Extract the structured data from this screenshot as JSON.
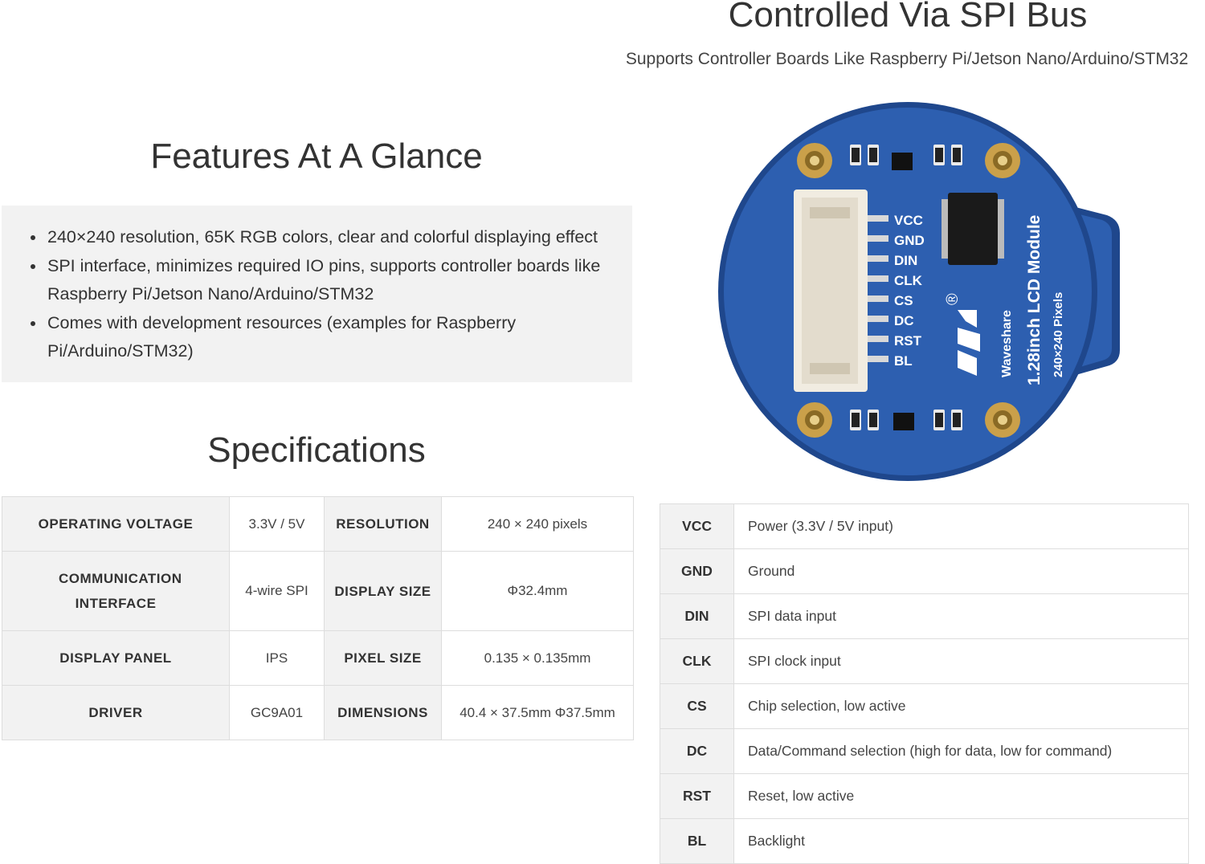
{
  "header": {
    "title": "Controlled Via SPI Bus",
    "subtitle": "Supports Controller Boards Like Raspberry Pi/Jetson Nano/Arduino/STM32"
  },
  "features": {
    "title": "Features At A Glance",
    "items": [
      "240×240 resolution, 65K RGB colors, clear and colorful displaying effect",
      "SPI interface, minimizes required IO pins, supports controller boards like Raspberry Pi/Jetson Nano/Arduino/STM32",
      "Comes with development resources (examples for Raspberry Pi/Arduino/STM32)"
    ]
  },
  "specifications": {
    "title": "Specifications",
    "rows": [
      {
        "label1": "OPERATING VOLTAGE",
        "value1": "3.3V / 5V",
        "label2": "RESOLUTION",
        "value2": "240 × 240 pixels"
      },
      {
        "label1": "COMMUNICATION INTERFACE",
        "value1": "4-wire SPI",
        "label2": "DISPLAY SIZE",
        "value2": "Φ32.4mm"
      },
      {
        "label1": "DISPLAY PANEL",
        "value1": "IPS",
        "label2": "PIXEL SIZE",
        "value2": "0.135 × 0.135mm"
      },
      {
        "label1": "DRIVER",
        "value1": "GC9A01",
        "label2": "DIMENSIONS",
        "value2": "40.4 × 37.5mm Φ37.5mm"
      }
    ]
  },
  "board": {
    "pin_labels": [
      "VCC",
      "GND",
      "DIN",
      "CLK",
      "CS",
      "DC",
      "RST",
      "BL"
    ],
    "brand": "Waveshare",
    "model": "1.28inch LCD Module",
    "pixels": "240×240 Pixels",
    "registered": "®",
    "board_color": "#2d5fb0",
    "edge_color": "#1f478c"
  },
  "pinout": {
    "rows": [
      {
        "pin": "VCC",
        "desc": "Power (3.3V / 5V input)"
      },
      {
        "pin": "GND",
        "desc": "Ground"
      },
      {
        "pin": "DIN",
        "desc": "SPI data input"
      },
      {
        "pin": "CLK",
        "desc": "SPI clock input"
      },
      {
        "pin": "CS",
        "desc": "Chip selection, low active"
      },
      {
        "pin": "DC",
        "desc": "Data/Command selection (high for data, low for command)"
      },
      {
        "pin": "RST",
        "desc": "Reset, low active"
      },
      {
        "pin": "BL",
        "desc": "Backlight"
      }
    ]
  }
}
